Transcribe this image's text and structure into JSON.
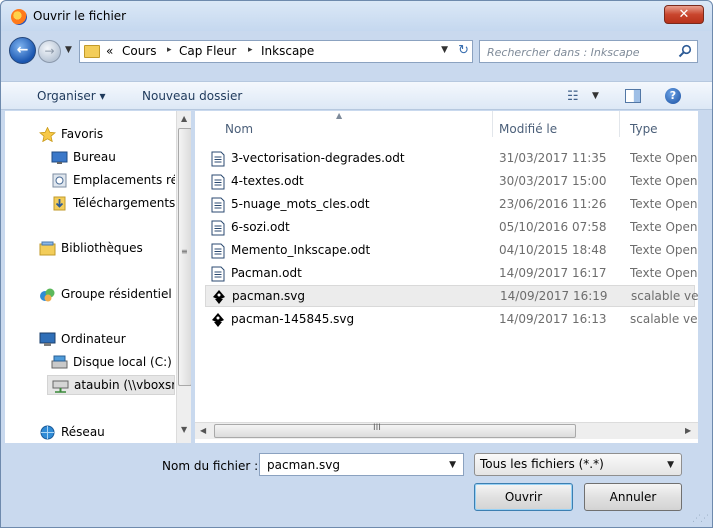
{
  "window": {
    "title": "Ouvrir le fichier",
    "close_glyph": "✕"
  },
  "address": {
    "overflow": "«",
    "breadcrumbs": [
      "Cours",
      "Cap Fleur",
      "Inkscape"
    ],
    "separator": "▸"
  },
  "search": {
    "placeholder": "Rechercher dans : Inkscape"
  },
  "toolbar": {
    "organize": "Organiser ▾",
    "new_folder": "Nouveau dossier",
    "help": "?"
  },
  "nav": {
    "items": [
      {
        "label": "Favoris",
        "icon": "star-icon"
      },
      {
        "label": "Bureau",
        "icon": "desktop-icon"
      },
      {
        "label": "Emplacements récents",
        "icon": "recent-places-icon"
      },
      {
        "label": "Téléchargements",
        "icon": "downloads-icon"
      },
      {
        "label": "Bibliothèques",
        "icon": "libraries-icon"
      },
      {
        "label": "Groupe résidentiel",
        "icon": "homegroup-icon"
      },
      {
        "label": "Ordinateur",
        "icon": "computer-icon"
      },
      {
        "label": "Disque local (C:)",
        "icon": "drive-icon"
      },
      {
        "label": "ataubin (\\\\vboxsrv)",
        "icon": "network-drive-icon"
      },
      {
        "label": "Réseau",
        "icon": "network-icon"
      }
    ],
    "selected_index": 8
  },
  "files": {
    "columns": {
      "name": "Nom",
      "modified": "Modifié le",
      "type": "Type"
    },
    "rows": [
      {
        "name": "3-vectorisation-degrades.odt",
        "modified": "31/03/2017 11:35",
        "type": "Texte OpenDocument",
        "icon": "document-icon"
      },
      {
        "name": "4-textes.odt",
        "modified": "30/03/2017 15:00",
        "type": "Texte OpenDocument",
        "icon": "document-icon"
      },
      {
        "name": "5-nuage_mots_cles.odt",
        "modified": "23/06/2016 11:26",
        "type": "Texte OpenDocument",
        "icon": "document-icon"
      },
      {
        "name": "6-sozi.odt",
        "modified": "05/10/2016 07:58",
        "type": "Texte OpenDocument",
        "icon": "document-icon"
      },
      {
        "name": "Memento_Inkscape.odt",
        "modified": "04/10/2015 18:48",
        "type": "Texte OpenDocument",
        "icon": "document-icon"
      },
      {
        "name": "Pacman.odt",
        "modified": "14/09/2017 16:17",
        "type": "Texte OpenDocument",
        "icon": "document-icon"
      },
      {
        "name": "pacman.svg",
        "modified": "14/09/2017 16:19",
        "type": "scalable vector graphics",
        "icon": "inkscape-svg-icon"
      },
      {
        "name": "pacman-145845.svg",
        "modified": "14/09/2017 16:13",
        "type": "scalable vector graphics",
        "icon": "inkscape-svg-icon"
      }
    ],
    "selected_index": 6
  },
  "footer": {
    "filename_label": "Nom du fichier :",
    "filename_value": "pacman.svg",
    "filter_value": "Tous les fichiers (*.*)",
    "open_label": "Ouvrir",
    "cancel_label": "Annuler"
  },
  "colors": {
    "accent": "#1a56b0",
    "window_frame": "#c9d9ee",
    "close_red": "#c9452d"
  }
}
